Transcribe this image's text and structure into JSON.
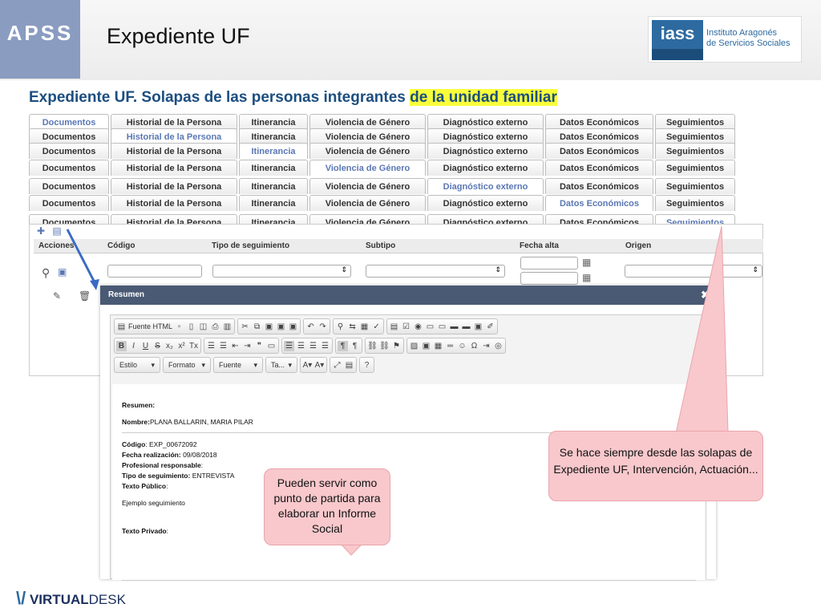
{
  "header": {
    "brand": "APSS",
    "title": "Expediente UF",
    "logo": {
      "box": "iass",
      "line1": "Instituto Aragonés",
      "line2": "de Servicios Sociales"
    }
  },
  "subtitle": {
    "part1": "Expediente UF. Solapas de las personas integrantes ",
    "part2": "de la unidad familiar"
  },
  "tab_rows": [
    {
      "tabs": [
        "Documentos",
        "Historial de la Persona",
        "Itinerancia",
        "Violencia de Género",
        "Diagnóstico externo",
        "Datos Económicos",
        "Seguimientos"
      ],
      "active": 0
    },
    {
      "tabs": [
        "Documentos",
        "Historial de la Persona",
        "Itinerancia",
        "Violencia de Género",
        "Diagnóstico externo",
        "Datos Económicos",
        "Seguimientos"
      ],
      "active": 1
    },
    {
      "tabs": [
        "Documentos",
        "Historial de la Persona",
        "Itinerancia",
        "Violencia de Género",
        "Diagnóstico externo",
        "Datos Económicos",
        "Seguimientos"
      ],
      "active": 2
    },
    {
      "tabs": [
        "Documentos",
        "Historial de la Persona",
        "Itinerancia",
        "Violencia de Género",
        "Diagnóstico externo",
        "Datos Económicos",
        "Seguimientos"
      ],
      "active": 3
    },
    {
      "tabs": [
        "Documentos",
        "Historial de la Persona",
        "Itinerancia",
        "Violencia de Género",
        "Diagnóstico externo",
        "Datos Económicos",
        "Seguimientos"
      ],
      "active": 4
    },
    {
      "tabs": [
        "Documentos",
        "Historial de la Persona",
        "Itinerancia",
        "Violencia de Género",
        "Diagnóstico externo",
        "Datos Económicos",
        "Seguimientos"
      ],
      "active": 5
    },
    {
      "tabs": [
        "Documentos",
        "Historial de la Persona",
        "Itinerancia",
        "Violencia de Género",
        "Diagnóstico externo",
        "Datos Económicos",
        "Seguimientos"
      ],
      "active": 6
    }
  ],
  "grid": {
    "columns": [
      "Acciones",
      "Código",
      "Tipo de seguimiento",
      "Subtipo",
      "Fecha alta",
      "Origen"
    ]
  },
  "modal": {
    "title": "Resumen",
    "close": "✖"
  },
  "toolbar": {
    "source": "Fuente HTML",
    "styles": [
      "Estilo",
      "Formato",
      "Fuente",
      "Ta..."
    ]
  },
  "doc": {
    "heading": "Resumen:",
    "nombre_label": "Nombre:",
    "nombre": "PLANA BALLARIN, MARIA PILAR",
    "codigo_label": "Código",
    "codigo": ": EXP_00672092",
    "fecha_label": "Fecha realización:",
    "fecha": " 09/08/2018",
    "prof_label": "Profesional responsable",
    ":": ":",
    "tipo_label": "Tipo de seguimiento:",
    "tipo": " ENTREVISTA",
    "publico_label": "Texto Público",
    "ejemplo": "Ejemplo seguimiento",
    "privado_label": "Texto Privado"
  },
  "callouts": {
    "right": "Se hace siempre desde las solapas de Expediente UF, Intervención, Actuación...",
    "left": "Pueden servir como punto de partida para elaborar un Informe Social"
  },
  "footer": {
    "logo_a": "VIRTUAL",
    "logo_b": "DESK"
  }
}
